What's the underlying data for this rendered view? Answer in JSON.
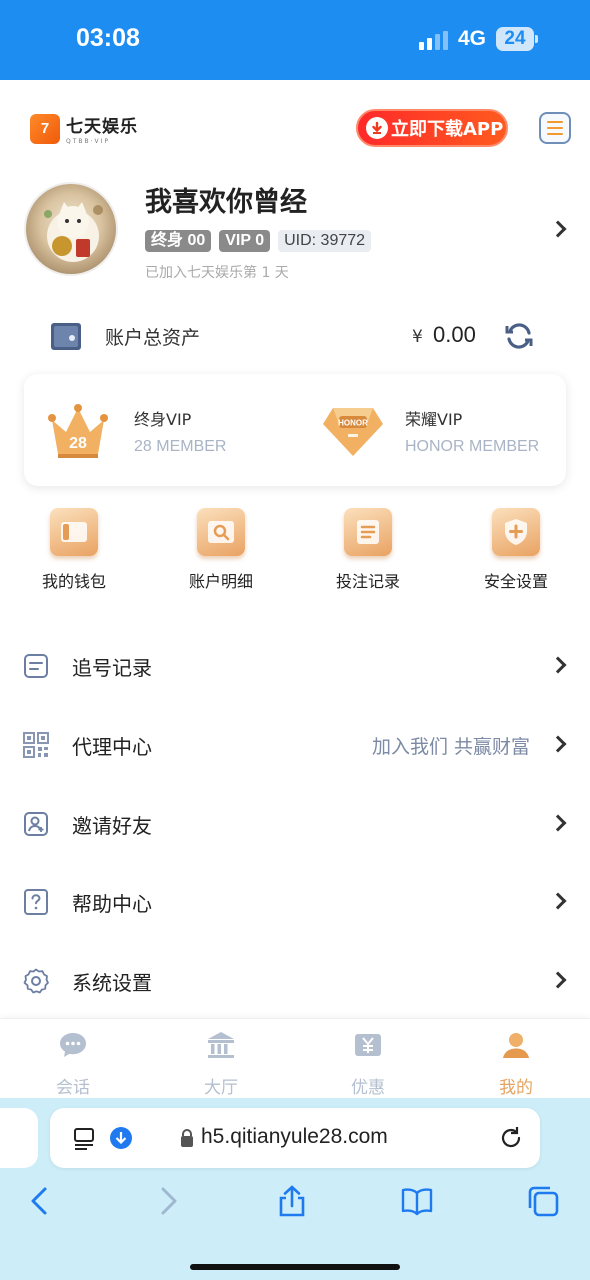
{
  "status_bar": {
    "time": "03:08",
    "network": "4G",
    "battery": "24"
  },
  "header": {
    "logo_text": "七天娱乐",
    "logo_subtext": "QTBB·VIP",
    "logo_mark": "7",
    "download_label": "立即下载APP"
  },
  "profile": {
    "username": "我喜欢你曾经",
    "tags": [
      "终身 00",
      "VIP 0",
      "UID: 39772"
    ],
    "joined": "已加入七天娱乐第 1 天"
  },
  "assets": {
    "label": "账户总资产",
    "currency": "¥",
    "value": "0.00"
  },
  "vip_cards": [
    {
      "title": "终身VIP",
      "subtitle": "28 MEMBER",
      "badge": "28",
      "icon": "crown-icon"
    },
    {
      "title": "荣耀VIP",
      "subtitle": "HONOR MEMBER",
      "badge": "HONOR",
      "icon": "diamond-icon"
    }
  ],
  "quick_actions": [
    {
      "label": "我的钱包",
      "icon": "wallet-icon"
    },
    {
      "label": "账户明细",
      "icon": "search-icon"
    },
    {
      "label": "投注记录",
      "icon": "document-icon"
    },
    {
      "label": "安全设置",
      "icon": "shield-icon"
    }
  ],
  "menu": [
    {
      "label": "追号记录",
      "note": "",
      "icon": "list-icon"
    },
    {
      "label": "代理中心",
      "note": "加入我们 共赢财富",
      "icon": "qrcode-icon"
    },
    {
      "label": "邀请好友",
      "note": "",
      "icon": "user-add-icon"
    },
    {
      "label": "帮助中心",
      "note": "",
      "icon": "help-icon"
    },
    {
      "label": "系统设置",
      "note": "",
      "icon": "gear-icon"
    }
  ],
  "tabbar": {
    "items": [
      {
        "label": "会话",
        "icon": "chat-icon",
        "active": false
      },
      {
        "label": "大厅",
        "icon": "hall-icon",
        "active": false
      },
      {
        "label": "优惠",
        "icon": "promo-icon",
        "active": false
      },
      {
        "label": "我的",
        "icon": "user-icon",
        "active": true
      }
    ]
  },
  "browser": {
    "url": "h5.qitianyule28.com"
  },
  "colors": {
    "status_bar": "#1e8df2",
    "accent": "#e4a462",
    "download_btn": "#ff2a2a",
    "muted_text": "#a9b4c6"
  }
}
